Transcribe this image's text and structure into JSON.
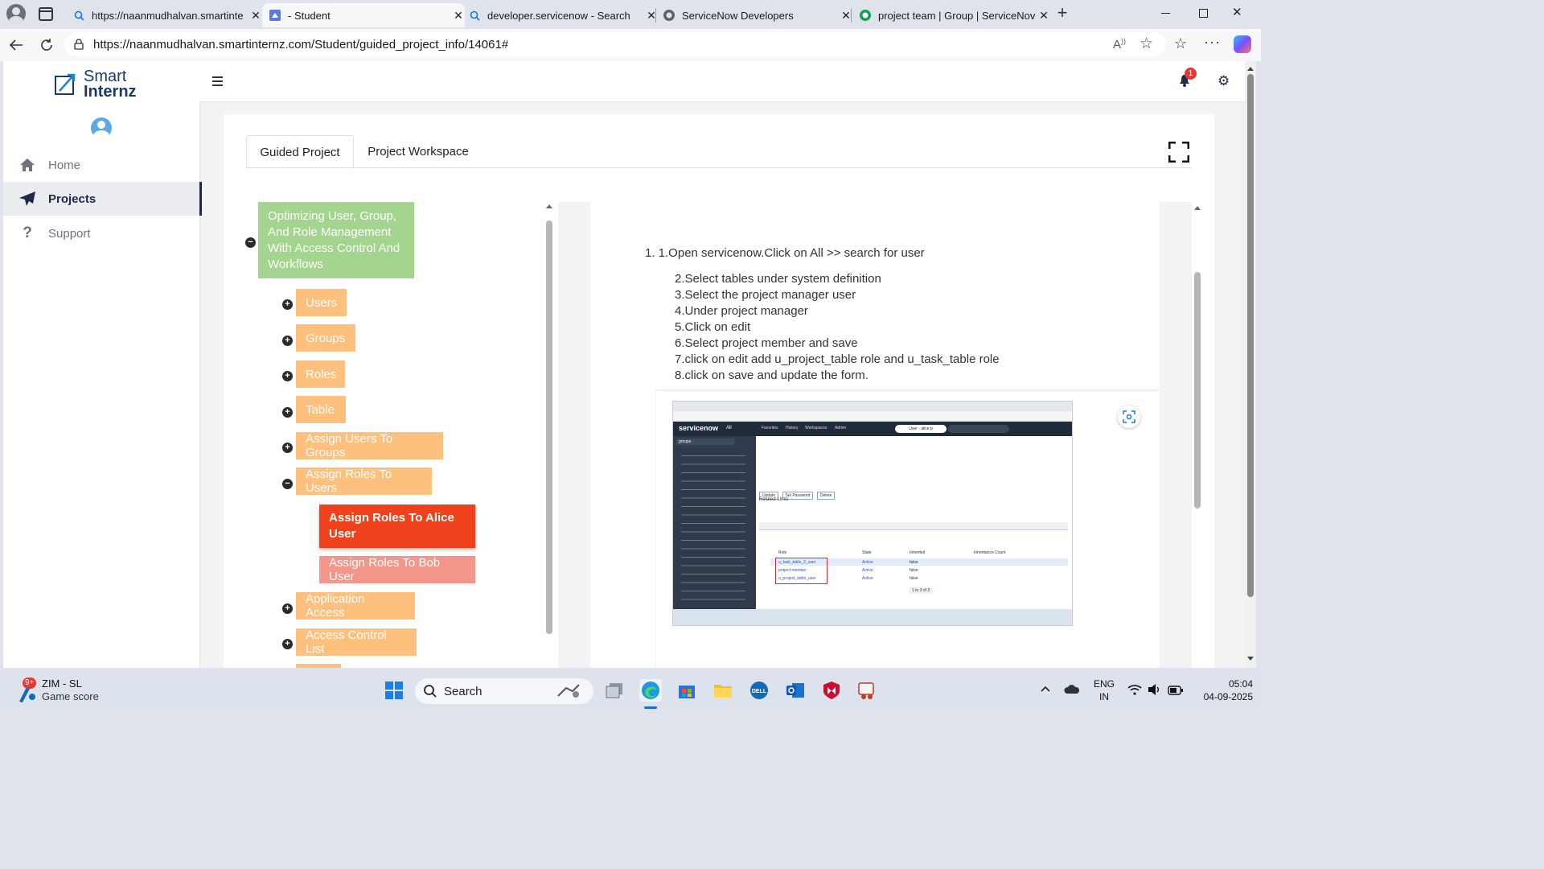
{
  "browser": {
    "tabs": [
      {
        "title": "https://naanmudhalvan.smartinte",
        "favicon": "search-icon",
        "active": false
      },
      {
        "title": "- Student",
        "favicon": "page-icon",
        "active": true
      },
      {
        "title": "developer.servicenow - Search",
        "favicon": "search-icon",
        "active": false
      },
      {
        "title": "ServiceNow Developers",
        "favicon": "servicenow-icon",
        "active": false
      },
      {
        "title": "project team | Group | ServiceNov",
        "favicon": "servicenow-green-icon",
        "active": false
      }
    ],
    "url": "https://naanmudhalvan.smartinternz.com/Student/guided_project_info/14061#"
  },
  "app": {
    "logo_line1": "Smart",
    "logo_line2": "Internz",
    "notification_count": "1",
    "nav": [
      {
        "label": "Home",
        "icon": "home-icon"
      },
      {
        "label": "Projects",
        "icon": "paper-plane-icon",
        "active": true
      },
      {
        "label": "Support",
        "icon": "question-icon"
      }
    ]
  },
  "project": {
    "tabs": [
      "Guided Project",
      "Project Workspace"
    ],
    "tree": {
      "root": "Optimizing User, Group, And Role Management With Access Control And Workflows",
      "items": [
        {
          "label": "Users",
          "toggle": "+"
        },
        {
          "label": "Groups",
          "toggle": "+"
        },
        {
          "label": "Roles",
          "toggle": "+"
        },
        {
          "label": "Table",
          "toggle": "+"
        },
        {
          "label": "Assign Users To Groups",
          "toggle": "+"
        },
        {
          "label": "Assign Roles To Users",
          "toggle": "−"
        },
        {
          "label": "Application Access",
          "toggle": "+"
        },
        {
          "label": "Access Control List",
          "toggle": "+"
        }
      ],
      "subitems": [
        {
          "label": "Assign Roles To Alice User",
          "active": true
        },
        {
          "label": "Assign Roles To Bob User",
          "active": false
        }
      ]
    },
    "steps": [
      "1.   1.Open servicenow.Click on All  >> search for user",
      "2.Select tables under system definition",
      "3.Select the project manager user",
      "4.Under project manager",
      "5.Click on edit",
      "6.Select project member and save",
      "7.click on edit add u_project_table role and u_task_table role",
      "8.click on save and  update the form."
    ]
  },
  "screenshot": {
    "logo": "servicenow",
    "all_tab": "All",
    "nav_tabs": [
      "Favorites",
      "History",
      "Workspaces",
      "Admin"
    ],
    "record": "User - alice p",
    "filter": "groups",
    "roles_table_headers": [
      "Role",
      "State",
      "Inherited",
      "Inheritance Count"
    ],
    "roles": [
      {
        "role": "u_task_table_2_user",
        "state": "Active",
        "inherited": "false"
      },
      {
        "role": "project member",
        "state": "Active",
        "inherited": "false"
      },
      {
        "role": "u_project_table_user",
        "state": "Active",
        "inherited": "false"
      }
    ],
    "buttons": [
      "Update",
      "Set Password",
      "Delete"
    ],
    "related_links_title": "Related Links",
    "pagination": "1 to 3 of 3"
  },
  "taskbar": {
    "widget_badge": "9+",
    "widget_title": "ZIM - SL",
    "widget_sub": "Game score",
    "search_label": "Search",
    "lang1": "ENG",
    "lang2": "IN",
    "time": "05:04",
    "date": "04-09-2025"
  }
}
